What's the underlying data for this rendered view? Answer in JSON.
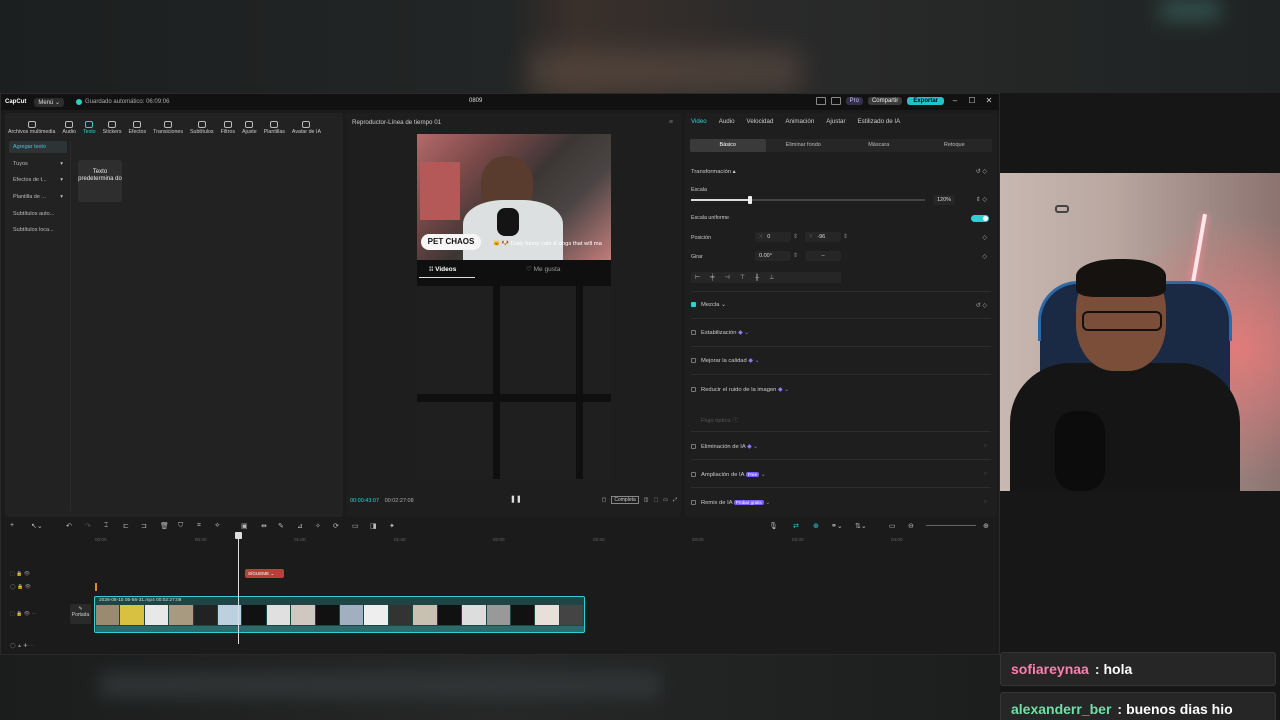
{
  "titlebar": {
    "logo": "CapCut",
    "menu": "Menú ⌄",
    "autosave": "Guardado automático: 06:09:06",
    "project": "0809",
    "pro": "Pro",
    "share": "Compartir",
    "export": "Exportar",
    "minimize": "–",
    "maximize": "☐",
    "close": "✕"
  },
  "toolbar": {
    "tools": [
      "Archivos multimedia",
      "Audio",
      "Texto",
      "Stickers",
      "Efectos",
      "Transiciones",
      "Subtítulos",
      "Filtros",
      "Ajuste",
      "Plantillas",
      "Avatar de IA"
    ]
  },
  "text_panel": {
    "side": [
      "Agregar texto",
      "Tuyos",
      "Efectos de t...",
      "Plantilla de ...",
      "Subtítulos auto...",
      "Subtítulos loca..."
    ],
    "card_label": "Texto predetermina do"
  },
  "player": {
    "title": "Reproductor-Línea de tiempo 01",
    "menu_icon": "≡",
    "logo_text": "PET CHAOS",
    "caption": "🐱 🐶 Daily funny cats & dogs that will ma",
    "tab_videos": "⁞⁞ Videos",
    "tab_likes": "♡ Me gusta",
    "time_current": "00:00:43:07",
    "time_total": "00:02:27:08",
    "play_icon": "❚❚",
    "ratio": "Completa"
  },
  "inspector": {
    "tabs": [
      "Video",
      "Audio",
      "Velocidad",
      "Animación",
      "Ajustar",
      "Estilizado de IA"
    ],
    "subtabs": [
      "Básico",
      "Eliminar fondo",
      "Máscara",
      "Retoque"
    ],
    "transform": "Transformación ▴",
    "scale_label": "Escala",
    "scale_value": "120%",
    "scale_fraction": 0.25,
    "uniform_scale": "Escala uniforme",
    "position_label": "Posición",
    "pos_x_label": "X",
    "pos_x": "0",
    "pos_y_label": "Y",
    "pos_y": "-96",
    "rotate_label": "Girar",
    "rotate_value": "0.00°",
    "rotate_dash": "–",
    "blend": "Mezcla ⌄",
    "stabilize": "Estabilización",
    "enhance": "Mejorar la calidad",
    "denoise": "Reducir el ruido de la imagen",
    "optical_flow": "Flujo óptico",
    "ai_remove": "Eliminación de IA",
    "ai_expand": "Ampliación de IA",
    "ai_expand_badge": "Free",
    "ai_remix": "Remix de IA",
    "ai_remix_badge": "Probar gratis"
  },
  "timeline": {
    "ruler": [
      "00:00",
      "00:30",
      "01:00",
      "01:30",
      "02:00",
      "02:30",
      "03:00",
      "03:30",
      "04:00"
    ],
    "red_segment": "SÍGUEME ⌄",
    "clip_label": "2026-08-15 05-56-31.mp4   00:02:27:08",
    "cover": "Portada"
  },
  "chat": [
    {
      "user": "sofiareynaa",
      "text": "hola",
      "color": "#ff7fb0"
    },
    {
      "user": "alexanderr_ber",
      "text": "buenos dias hio",
      "color": "#6fe0a8"
    }
  ],
  "colors": {
    "accent": "#2fd0d4",
    "export": "#22c3c7",
    "clip_border": "#2fd0d4"
  }
}
